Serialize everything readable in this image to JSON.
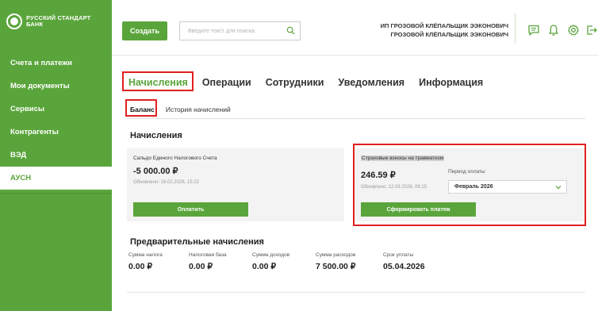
{
  "brand": {
    "line1": "РУССКИЙ СТАНДАРТ",
    "line2": "БАНК"
  },
  "sidebar": {
    "items": [
      {
        "label": "Счета и платежи"
      },
      {
        "label": "Мои документы"
      },
      {
        "label": "Сервисы"
      },
      {
        "label": "Контрагенты"
      },
      {
        "label": "ВЭД"
      },
      {
        "label": "АУСН",
        "active": true
      }
    ]
  },
  "header": {
    "create_label": "Создать",
    "search_placeholder": "Введите текст для поиска",
    "company_line1": "ИП ГРОЗОВОЙ КЛЁПАЛЬЩИК ЭЭКОНОВИЧ",
    "company_line2": "ГРОЗОВОЙ КЛЁПАЛЬЩИК ЭЭКОНОВИЧ",
    "icons": [
      "chat-icon",
      "bell-icon",
      "gear-icon",
      "logout-icon"
    ]
  },
  "tabs": [
    {
      "label": "Начисления",
      "active": true
    },
    {
      "label": "Операции"
    },
    {
      "label": "Сотрудники"
    },
    {
      "label": "Уведомления"
    },
    {
      "label": "Информация"
    }
  ],
  "subtabs": [
    {
      "label": "Баланс",
      "active": true
    },
    {
      "label": "История начислений"
    }
  ],
  "accruals": {
    "title": "Начисления",
    "ens": {
      "label": "Сальдо Единого Налогового Счета",
      "amount": "-5 000.00 ₽",
      "updated": "Обновлено: 16.02.2026, 15:22",
      "button": "Оплатить"
    },
    "injury": {
      "label": "Страховые взносы на травматизм",
      "amount": "246.59 ₽",
      "updated": "Обновлено: 12.03.2026, 08:15",
      "period_label": "Период оплаты",
      "period_value": "Февраль 2026",
      "button": "Сформировать платеж"
    }
  },
  "preliminary": {
    "title": "Предварительные начисления",
    "stats": [
      {
        "label": "Сумма налога",
        "value": "0.00 ₽"
      },
      {
        "label": "Налоговая база",
        "value": "0.00 ₽"
      },
      {
        "label": "Сумма доходов",
        "value": "0.00 ₽"
      },
      {
        "label": "Сумма расходов",
        "value": "7 500.00 ₽"
      },
      {
        "label": "Срок уплаты",
        "value": "05.04.2026"
      }
    ]
  },
  "colors": {
    "brand_green": "#5aa53b",
    "highlight_red": "#e02020"
  }
}
